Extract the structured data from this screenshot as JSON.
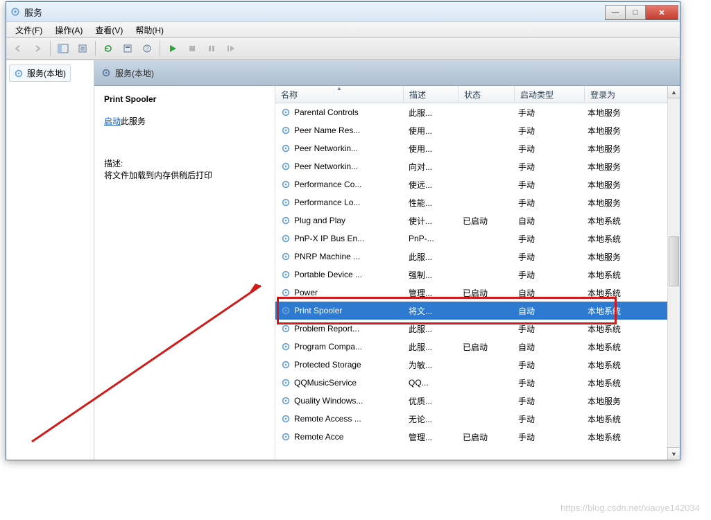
{
  "window": {
    "title": "服务"
  },
  "menu": {
    "file": "文件(F)",
    "action": "操作(A)",
    "view": "查看(V)",
    "help": "帮助(H)"
  },
  "tree": {
    "root": "服务(本地)"
  },
  "pane": {
    "header": "服务(本地)"
  },
  "detail": {
    "service_name": "Print Spooler",
    "start_link": "启动",
    "start_suffix": "此服务",
    "desc_label": "描述:",
    "desc_text": "将文件加载到内存供稍后打印"
  },
  "columns": {
    "name": "名称",
    "desc": "描述",
    "status": "状态",
    "startup": "启动类型",
    "logon": "登录为"
  },
  "col_widths": {
    "name": 168,
    "desc": 62,
    "status": 64,
    "startup": 84,
    "logon": 120
  },
  "rows": [
    {
      "name": "Parental Controls",
      "desc": "此服...",
      "status": "",
      "startup": "手动",
      "logon": "本地服务"
    },
    {
      "name": "Peer Name Res...",
      "desc": "使用...",
      "status": "",
      "startup": "手动",
      "logon": "本地服务"
    },
    {
      "name": "Peer Networkin...",
      "desc": "使用...",
      "status": "",
      "startup": "手动",
      "logon": "本地服务"
    },
    {
      "name": "Peer Networkin...",
      "desc": "向对...",
      "status": "",
      "startup": "手动",
      "logon": "本地服务"
    },
    {
      "name": "Performance Co...",
      "desc": "使远...",
      "status": "",
      "startup": "手动",
      "logon": "本地服务"
    },
    {
      "name": "Performance Lo...",
      "desc": "性能...",
      "status": "",
      "startup": "手动",
      "logon": "本地服务"
    },
    {
      "name": "Plug and Play",
      "desc": "使计...",
      "status": "已启动",
      "startup": "自动",
      "logon": "本地系统"
    },
    {
      "name": "PnP-X IP Bus En...",
      "desc": "PnP-...",
      "status": "",
      "startup": "手动",
      "logon": "本地系统"
    },
    {
      "name": "PNRP Machine ...",
      "desc": "此服...",
      "status": "",
      "startup": "手动",
      "logon": "本地服务"
    },
    {
      "name": "Portable Device ...",
      "desc": "强制...",
      "status": "",
      "startup": "手动",
      "logon": "本地系统"
    },
    {
      "name": "Power",
      "desc": "管理...",
      "status": "已启动",
      "startup": "自动",
      "logon": "本地系统"
    },
    {
      "name": "Print Spooler",
      "desc": "将文...",
      "status": "",
      "startup": "自动",
      "logon": "本地系统",
      "selected": true
    },
    {
      "name": "Problem Report...",
      "desc": "此服...",
      "status": "",
      "startup": "手动",
      "logon": "本地系统"
    },
    {
      "name": "Program Compa...",
      "desc": "此服...",
      "status": "已启动",
      "startup": "自动",
      "logon": "本地系统"
    },
    {
      "name": "Protected Storage",
      "desc": "为敏...",
      "status": "",
      "startup": "手动",
      "logon": "本地系统"
    },
    {
      "name": "QQMusicService",
      "desc": "QQ...",
      "status": "",
      "startup": "手动",
      "logon": "本地系统"
    },
    {
      "name": "Quality Windows...",
      "desc": "优质...",
      "status": "",
      "startup": "手动",
      "logon": "本地服务"
    },
    {
      "name": "Remote Access ...",
      "desc": "无论...",
      "status": "",
      "startup": "手动",
      "logon": "本地系统"
    },
    {
      "name": "Remote Acce",
      "desc": "管理...",
      "status": "已启动",
      "startup": "手动",
      "logon": "本地系统"
    }
  ],
  "watermark": "https://blog.csdn.net/xiaoye142034"
}
